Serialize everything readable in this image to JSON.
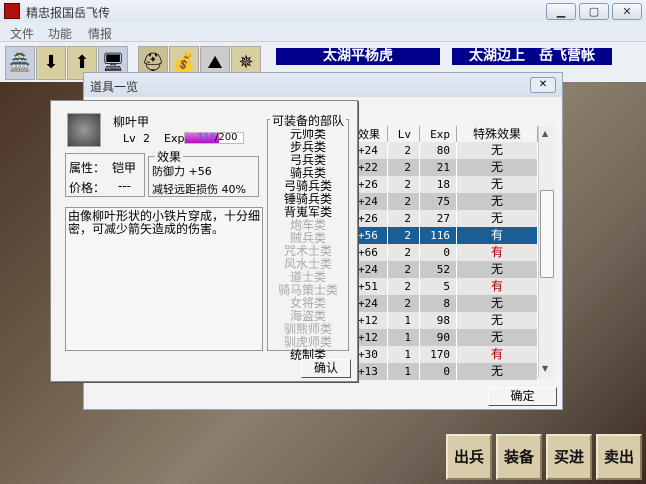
{
  "app": {
    "title": "精忠报国岳飞传",
    "minimize": "▁",
    "maximize": "▢",
    "close": "✕"
  },
  "menu": [
    "文件",
    "功能",
    "情报"
  ],
  "toolbar": {
    "icons": [
      "castle-icon",
      "load-icon",
      "save-icon",
      "computer-icon",
      "helmet-icon",
      "money-bag-icon",
      "mountain-icon",
      "emblem-icon"
    ]
  },
  "banners": [
    "太湖平杨虎",
    "太湖边上　岳飞营帐"
  ],
  "window": {
    "title": "道具一览",
    "close": "✕",
    "ok": "确定"
  },
  "detail": {
    "name": "柳叶甲",
    "lv_label": "Lv",
    "lv": "2",
    "exp_label": "Exp",
    "exp": "116",
    "exp_max": "/200",
    "exp_fraction": 0.58,
    "attr_label": "属性：",
    "attr": "铠甲",
    "price_label": "价格：",
    "price": "---",
    "effect_legend": "效果",
    "effects": [
      "防御力 +56",
      "减轻远距损伤 40%"
    ],
    "description": "由像柳叶形状的小铁片穿成，十分细密，可减少箭矢造成的伤害。",
    "units_legend": "可装备的部队",
    "units": [
      {
        "n": "元帅类",
        "on": true
      },
      {
        "n": "步兵类",
        "on": true
      },
      {
        "n": "弓兵类",
        "on": true
      },
      {
        "n": "骑兵类",
        "on": true
      },
      {
        "n": "弓骑兵类",
        "on": true
      },
      {
        "n": "锤骑兵类",
        "on": true
      },
      {
        "n": "背嵬军类",
        "on": true
      },
      {
        "n": "炮车类",
        "on": false
      },
      {
        "n": "贼兵类",
        "on": false
      },
      {
        "n": "咒术士类",
        "on": false
      },
      {
        "n": "风水士类",
        "on": false
      },
      {
        "n": "道士类",
        "on": false
      },
      {
        "n": "骑马策士类",
        "on": false
      },
      {
        "n": "女将类",
        "on": false
      },
      {
        "n": "海盗类",
        "on": false
      },
      {
        "n": "驯熊师类",
        "on": false
      },
      {
        "n": "驯虎师类",
        "on": false
      },
      {
        "n": "统制类",
        "on": true
      }
    ],
    "confirm": "确认"
  },
  "table": {
    "headers": [
      "效果",
      "Lv",
      "Exp",
      "特殊效果"
    ],
    "rows": [
      [
        "+24",
        "2",
        "80",
        "无"
      ],
      [
        "+22",
        "2",
        "21",
        "无"
      ],
      [
        "+26",
        "2",
        "18",
        "无"
      ],
      [
        "+24",
        "2",
        "75",
        "无"
      ],
      [
        "+26",
        "2",
        "27",
        "无"
      ],
      [
        "+56",
        "2",
        "116",
        "有"
      ],
      [
        "+66",
        "2",
        "0",
        "有"
      ],
      [
        "+24",
        "2",
        "52",
        "无"
      ],
      [
        "+51",
        "2",
        "5",
        "有"
      ],
      [
        "+24",
        "2",
        "8",
        "无"
      ],
      [
        "+12",
        "1",
        "98",
        "无"
      ],
      [
        "+12",
        "1",
        "90",
        "无"
      ],
      [
        "+30",
        "1",
        "170",
        "有"
      ],
      [
        "+13",
        "1",
        "0",
        "无"
      ]
    ],
    "selected": 5
  },
  "actions": [
    "出兵",
    "装备",
    "买进",
    "卖出"
  ]
}
